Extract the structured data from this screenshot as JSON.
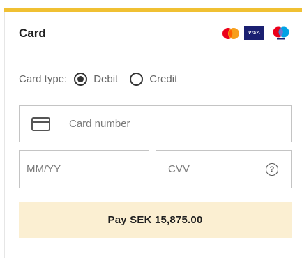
{
  "colors": {
    "accent_bar": "#f0c033",
    "pay_button_bg": "#fbefd2"
  },
  "card": {
    "title": "Card",
    "brands": [
      "mastercard-icon",
      "visa-icon",
      "maestro-icon"
    ],
    "visa_text": "VISA",
    "card_type_label": "Card type:",
    "options": [
      {
        "label": "Debit",
        "selected": true
      },
      {
        "label": "Credit",
        "selected": false
      }
    ],
    "card_number_placeholder": "Card number",
    "expiry_placeholder": "MM/YY",
    "cvv_placeholder": "CVV",
    "help_icon_glyph": "?",
    "pay_label": "Pay SEK 15,875.00"
  }
}
